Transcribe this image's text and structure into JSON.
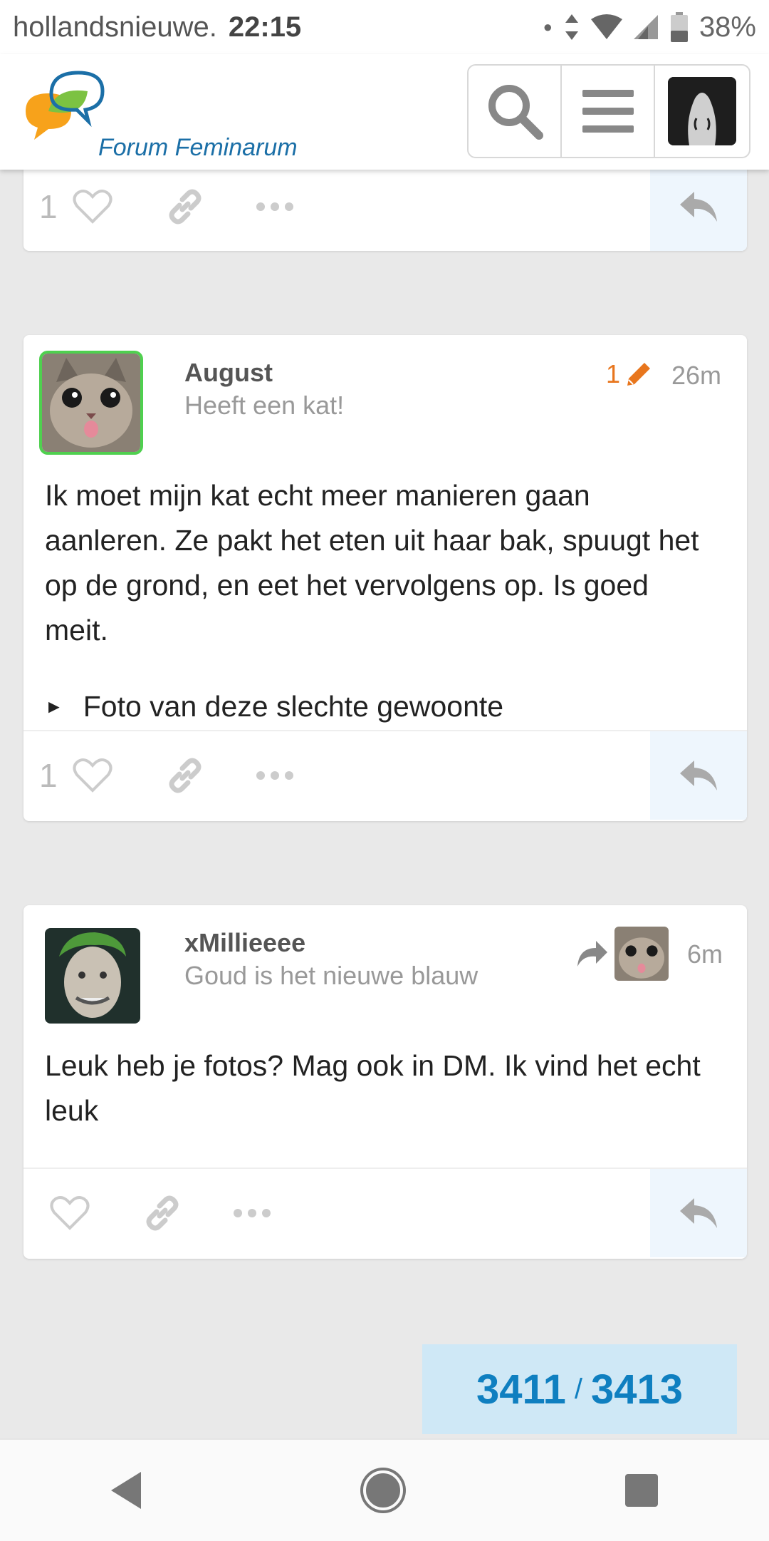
{
  "status_bar": {
    "carrier": "hollandsnieuwe.",
    "time": "22:15",
    "battery": "38%"
  },
  "header": {
    "logo_text": "Forum Feminarum",
    "logo_colors": {
      "bubble_orange": "#f7a21b",
      "leaf_green": "#7cc242",
      "bubble_blue": "#1b6fa7"
    }
  },
  "posts": [
    {
      "like_count": "1"
    },
    {
      "username": "August",
      "user_title": "Heeft een kat!",
      "edit_count": "1",
      "time": "26m",
      "body": "Ik moet mijn kat echt meer manieren gaan aanleren. Ze pakt het eten uit haar bak, spuugt het op de grond, en eet het vervolgens op. Is goed meit.",
      "details_summary": "Foto van deze slechte gewoonte",
      "like_count": "1"
    },
    {
      "username": "xMillieeee",
      "user_title": "Goud is het nieuwe blauw",
      "time": "6m",
      "body": "Leuk heb je fotos? Mag ook in DM. Ik vind het echt leuk",
      "like_count": ""
    }
  ],
  "progress": {
    "current": "3411",
    "separator": "/",
    "total": "3413"
  },
  "colors": {
    "accent": "#0f7fc0",
    "edit": "#e8761d",
    "avatar_border": "#4fd04f",
    "reply_bg": "#eef6fd"
  }
}
